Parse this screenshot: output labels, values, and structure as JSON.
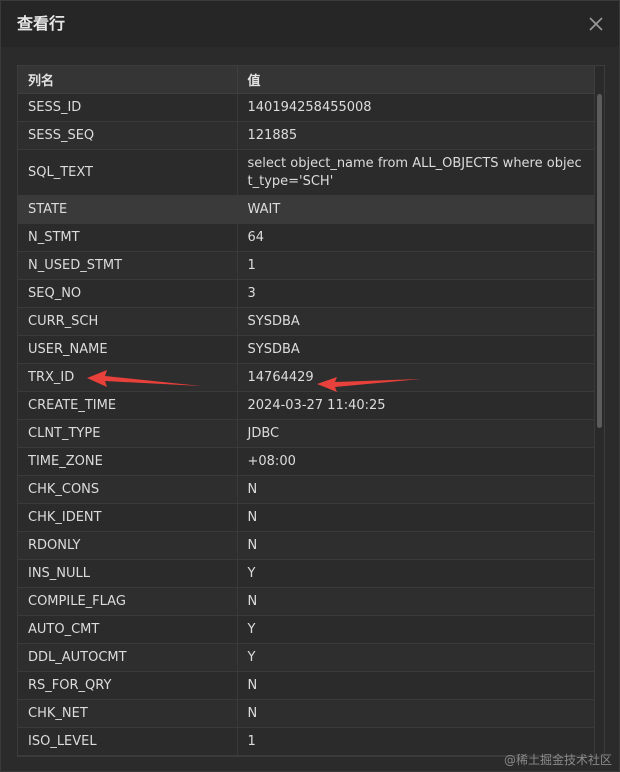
{
  "dialog": {
    "title": "查看行",
    "close_icon": "close-icon"
  },
  "table": {
    "columns": [
      "列名",
      "值"
    ],
    "rows": [
      {
        "name": "SESS_ID",
        "value": "140194258455008"
      },
      {
        "name": "SESS_SEQ",
        "value": "121885"
      },
      {
        "name": "SQL_TEXT",
        "value": "select object_name from ALL_OBJECTS where object_type='SCH'"
      },
      {
        "name": "STATE",
        "value": "WAIT"
      },
      {
        "name": "N_STMT",
        "value": "64"
      },
      {
        "name": "N_USED_STMT",
        "value": "1"
      },
      {
        "name": "SEQ_NO",
        "value": "3"
      },
      {
        "name": "CURR_SCH",
        "value": "SYSDBA"
      },
      {
        "name": "USER_NAME",
        "value": "SYSDBA"
      },
      {
        "name": "TRX_ID",
        "value": "14764429"
      },
      {
        "name": "CREATE_TIME",
        "value": "2024-03-27 11:40:25"
      },
      {
        "name": "CLNT_TYPE",
        "value": "JDBC"
      },
      {
        "name": "TIME_ZONE",
        "value": "+08:00"
      },
      {
        "name": "CHK_CONS",
        "value": "N"
      },
      {
        "name": "CHK_IDENT",
        "value": "N"
      },
      {
        "name": "RDONLY",
        "value": "N"
      },
      {
        "name": "INS_NULL",
        "value": "Y"
      },
      {
        "name": "COMPILE_FLAG",
        "value": "N"
      },
      {
        "name": "AUTO_CMT",
        "value": "Y"
      },
      {
        "name": "DDL_AUTOCMT",
        "value": "Y"
      },
      {
        "name": "RS_FOR_QRY",
        "value": "N"
      },
      {
        "name": "CHK_NET",
        "value": "N"
      },
      {
        "name": "ISO_LEVEL",
        "value": "1"
      }
    ]
  },
  "annotations": {
    "arrow_color": "#e8403a",
    "arrow_icon": "red-arrow-icon"
  },
  "watermark": "@稀土掘金技术社区"
}
